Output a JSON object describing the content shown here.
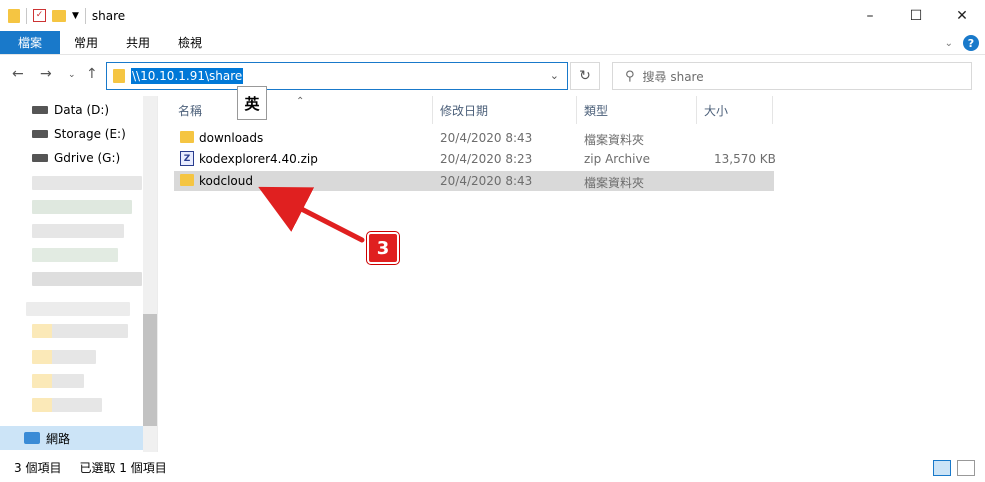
{
  "window": {
    "title": "share"
  },
  "ribbon": {
    "tabs": [
      "檔案",
      "常用",
      "共用",
      "檢視"
    ],
    "help": "?"
  },
  "address": {
    "path": "\\\\10.10.1.91\\share"
  },
  "search": {
    "placeholder": "搜尋 share"
  },
  "ime": {
    "indicator": "英"
  },
  "sidebar": {
    "drives": [
      {
        "label": "Data (D:)"
      },
      {
        "label": "Storage (E:)"
      },
      {
        "label": "Gdrive (G:)"
      }
    ],
    "network_label": "網路"
  },
  "columns": {
    "name": "名稱",
    "modified": "修改日期",
    "type": "類型",
    "size": "大小"
  },
  "files": [
    {
      "name": "downloads",
      "modified": "20/4/2020 8:43",
      "type": "檔案資料夾",
      "size": "",
      "icon": "folder-icon"
    },
    {
      "name": "kodexplorer4.40.zip",
      "modified": "20/4/2020 8:23",
      "type": "zip Archive",
      "size": "13,570 KB",
      "icon": "zip-icon"
    },
    {
      "name": "kodcloud",
      "modified": "20/4/2020 8:43",
      "type": "檔案資料夾",
      "size": "",
      "icon": "folder-icon"
    }
  ],
  "status": {
    "item_count": "3 個項目",
    "selected": "已選取 1 個項目"
  },
  "annotation": {
    "step": "3"
  },
  "colors": {
    "accent": "#1979ca",
    "annotation": "#e02020",
    "folder": "#f5c542",
    "selection": "#d9d9d9"
  }
}
